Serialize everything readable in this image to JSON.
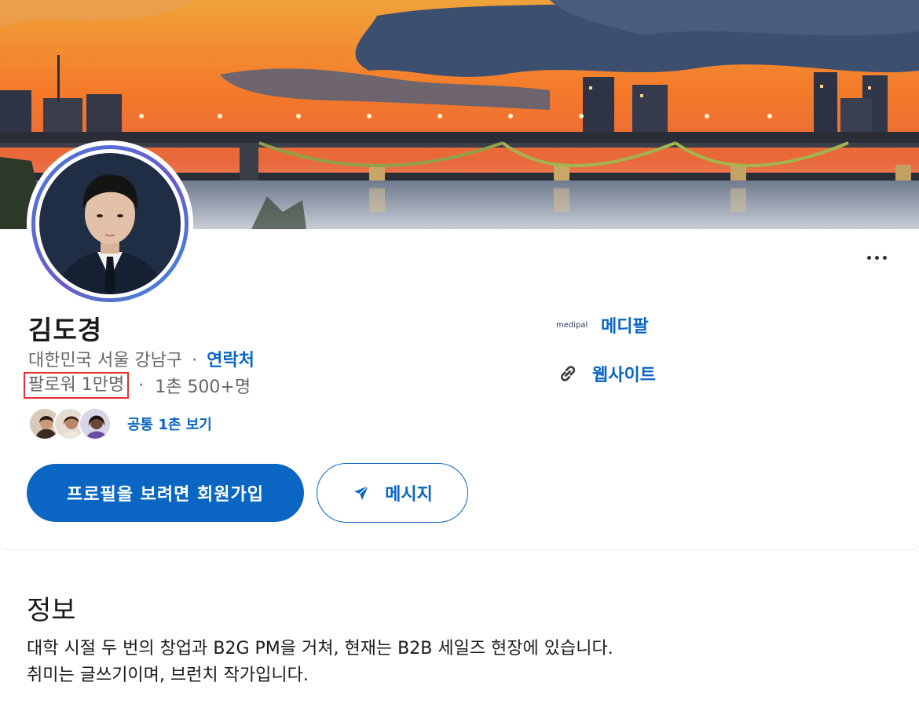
{
  "profile": {
    "name": "김도경",
    "location": "대한민국 서울 강남구",
    "contact_label": "연락처",
    "followers": "팔로워 1만명",
    "connections": "1촌 500+명",
    "mutual_label": "공통 1촌 보기",
    "more_icon": "more-horizontal-icon"
  },
  "actions": {
    "join_label": "프로필을 보려면 회원가입",
    "message_label": "메시지",
    "message_icon": "send-icon"
  },
  "side": {
    "company_logo_text": "medipal",
    "company_name": "메디팔",
    "website_icon": "link-icon",
    "website_label": "웹사이트"
  },
  "about": {
    "title": "정보",
    "line1": "대학 시절 두 번의 창업과 B2G PM을 거쳐, 현재는 B2B 세일즈 현장에 있습니다.",
    "line2": "취미는 글쓰기이며, 브런치 작가입니다."
  },
  "colors": {
    "accent": "#0a66c2",
    "highlight_border": "#e53030",
    "text_secondary": "#666666"
  }
}
